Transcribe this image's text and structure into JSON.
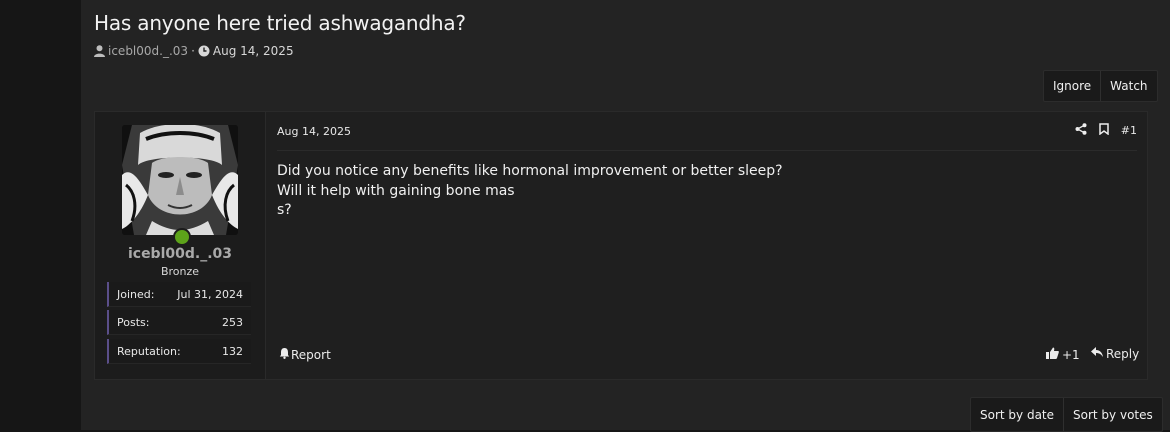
{
  "thread": {
    "title": "Has anyone here tried ashwagandha?",
    "author": "icebl00d._.03",
    "separator": "·",
    "date": "Aug 14, 2025"
  },
  "actions": {
    "ignore": "Ignore",
    "watch": "Watch"
  },
  "post": {
    "user": {
      "name": "icebl00d._.03",
      "rank": "Bronze",
      "online": true,
      "stats": [
        {
          "label": "Joined:",
          "value": "Jul 31, 2024"
        },
        {
          "label": "Posts:",
          "value": "253"
        },
        {
          "label": "Reputation:",
          "value": "132"
        }
      ]
    },
    "date": "Aug 14, 2025",
    "number": "#1",
    "body": [
      "Did you notice any benefits like hormonal improvement or better sleep?",
      "Will it help with gaining bone mas",
      "s?"
    ],
    "report": "Report",
    "reaction_count": "+1",
    "reply": "Reply"
  },
  "sort": {
    "by_date": "Sort by date",
    "by_votes": "Sort by votes"
  },
  "colors": {
    "page_bg": "#232323",
    "outer_bg": "#161616",
    "online": "#5da31a",
    "stat_accent": "#5b4f8a"
  },
  "icons": [
    "user-icon",
    "clock-icon",
    "share-icon",
    "bookmark-icon",
    "bell-icon",
    "thumbs-up-icon",
    "reply-icon"
  ]
}
